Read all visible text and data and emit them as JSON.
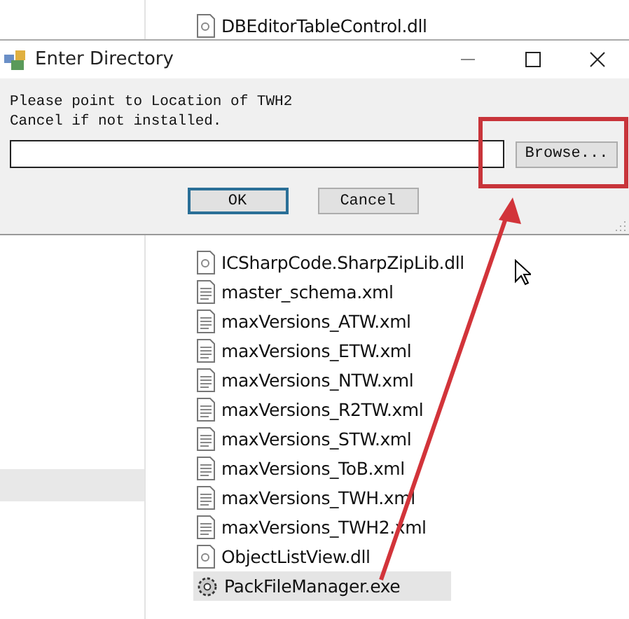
{
  "explorer": {
    "files_top": [
      {
        "name": "DBEditorTableControl.dll",
        "kind": "dll",
        "selected": false
      }
    ],
    "files": [
      {
        "name": "ICSharpCode.SharpZipLib.dll",
        "kind": "dll",
        "selected": false
      },
      {
        "name": "master_schema.xml",
        "kind": "xml",
        "selected": false
      },
      {
        "name": "maxVersions_ATW.xml",
        "kind": "xml",
        "selected": false
      },
      {
        "name": "maxVersions_ETW.xml",
        "kind": "xml",
        "selected": false
      },
      {
        "name": "maxVersions_NTW.xml",
        "kind": "xml",
        "selected": false
      },
      {
        "name": "maxVersions_R2TW.xml",
        "kind": "xml",
        "selected": false
      },
      {
        "name": "maxVersions_STW.xml",
        "kind": "xml",
        "selected": false
      },
      {
        "name": "maxVersions_ToB.xml",
        "kind": "xml",
        "selected": false
      },
      {
        "name": "maxVersions_TWH.xml",
        "kind": "xml",
        "selected": false
      },
      {
        "name": "maxVersions_TWH2.xml",
        "kind": "xml",
        "selected": false
      },
      {
        "name": "ObjectListView.dll",
        "kind": "dll",
        "selected": false
      },
      {
        "name": "PackFileManager.exe",
        "kind": "exe",
        "selected": true
      }
    ]
  },
  "dialog": {
    "title": "Enter Directory",
    "message_lines": [
      "Please point to Location of TWH2",
      "Cancel if not installed."
    ],
    "browse_button": "Browse...",
    "ok_button": "OK",
    "cancel_button": "Cancel"
  }
}
